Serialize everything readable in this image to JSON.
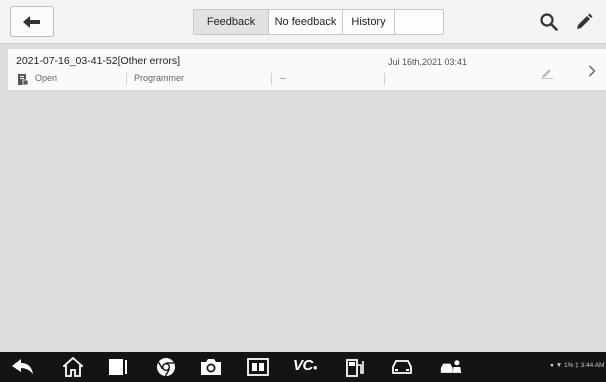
{
  "header": {
    "tabs": [
      {
        "label": "Feedback",
        "active": true
      },
      {
        "label": "No feedback",
        "active": false
      },
      {
        "label": "History",
        "active": false
      }
    ]
  },
  "records": [
    {
      "title": "2021-07-16_03-41-52[Other errors]",
      "status": "Open",
      "category": "Programmer",
      "extra": "--",
      "datetime": "Jul 16th,2021 03:41"
    }
  ],
  "statusbar": {
    "text": "● ▼ 1% ‡ 3:44 AM"
  },
  "colors": {
    "topbar": "#f3f3f3",
    "content_bg": "#dcdcdc",
    "navbar": "#141414",
    "active_tab": "#e2e2e2"
  },
  "icons": {
    "back": "back-arrow-icon",
    "search": "search-icon",
    "edit": "pencil-icon",
    "row_doc": "document-icon",
    "row_edit": "pencil-icon",
    "row_open": "chevron-right-icon"
  },
  "navbar_icons": [
    "back-icon",
    "home-icon",
    "recent-apps-icon",
    "chrome-icon",
    "camera-icon",
    "screen-capture-icon",
    "vci-icon",
    "fuel-station-icon",
    "car-icon",
    "car-service-icon"
  ],
  "vci_label": "VC"
}
